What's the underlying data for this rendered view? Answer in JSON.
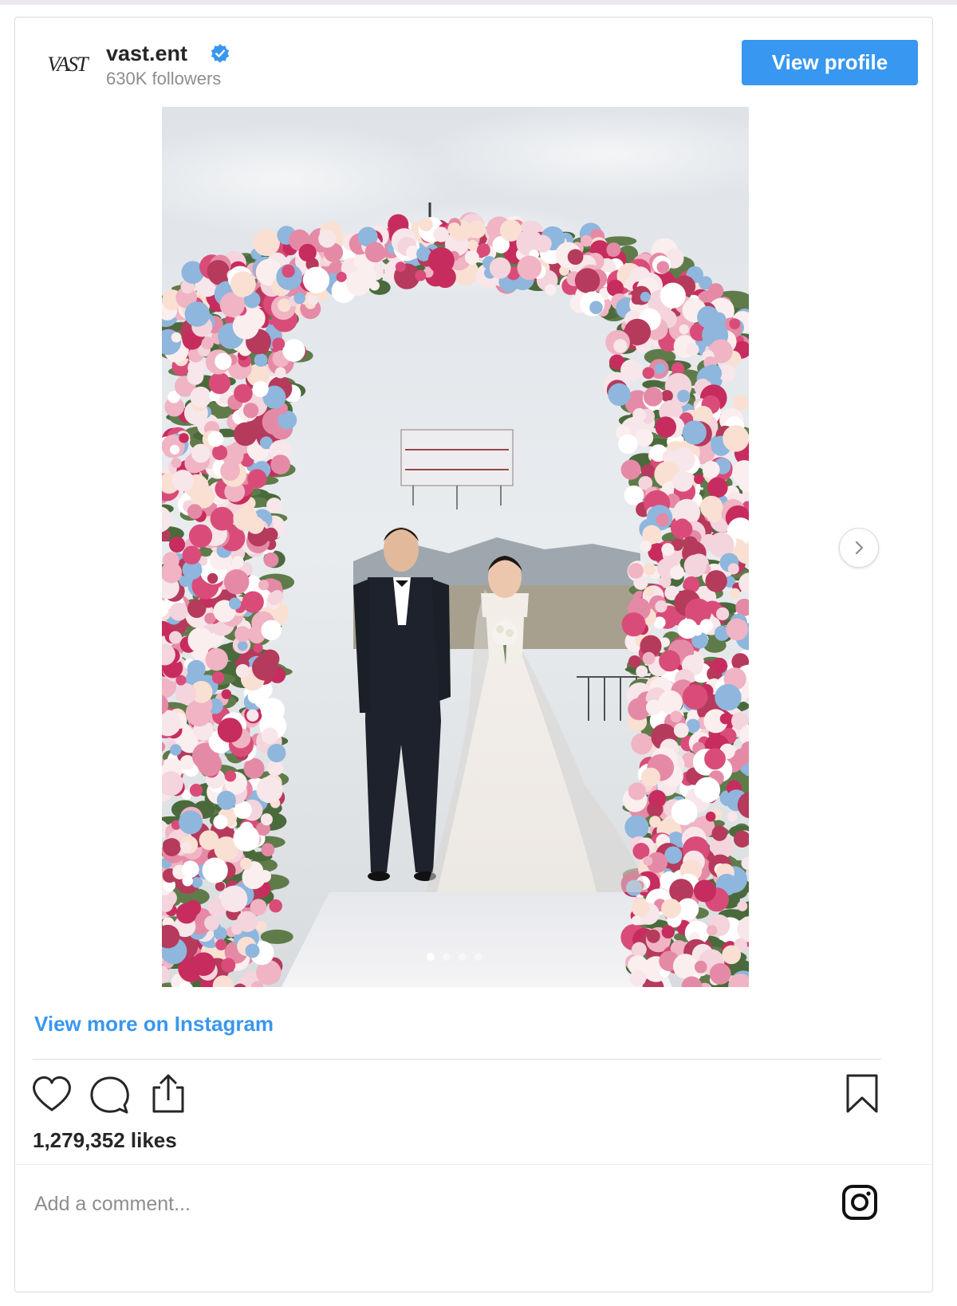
{
  "header": {
    "avatar_text": "VAST",
    "account_name": "vast.ent",
    "followers": "630K followers",
    "view_profile_label": "View profile"
  },
  "post": {
    "carousel_count": 4,
    "carousel_active": 1,
    "view_more_label": "View more on Instagram",
    "likes_text": "1,279,352 likes"
  },
  "comment": {
    "placeholder": "Add a comment..."
  },
  "icons": {
    "like": "heart-icon",
    "comment": "comment-icon",
    "share": "share-icon",
    "save": "bookmark-icon",
    "next": "chevron-right-icon",
    "verified": "verified-badge-icon",
    "brand": "instagram-logo-icon"
  },
  "colors": {
    "accent": "#3897f0",
    "text": "#262626",
    "muted": "#8e8e8e",
    "border": "#dbdbdb"
  }
}
